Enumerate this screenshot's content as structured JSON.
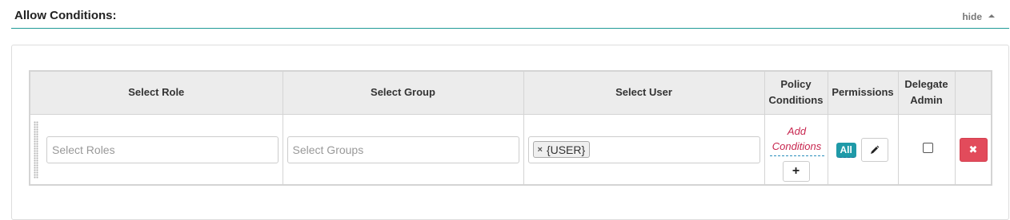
{
  "section": {
    "title": "Allow Conditions:",
    "toggle_label": "hide"
  },
  "table": {
    "headers": {
      "role": "Select Role",
      "group": "Select Group",
      "user": "Select User",
      "policy_line1": "Policy",
      "policy_line2": "Conditions",
      "permissions": "Permissions",
      "delegate_line1": "Delegate",
      "delegate_line2": "Admin"
    },
    "row": {
      "roles_placeholder": "Select Roles",
      "groups_placeholder": "Select Groups",
      "user_tokens": [
        "{USER}"
      ],
      "token_remove": "×",
      "add_conditions_line1": "Add",
      "add_conditions_line2": "Conditions",
      "add_button": "+",
      "permissions_badge": "All",
      "delegate_admin_checked": false,
      "delete_symbol": "✖"
    }
  },
  "colors": {
    "accent": "#1e9b96",
    "badge": "#1f9aa8",
    "danger": "#e24b5b",
    "link": "#c7254e"
  },
  "icons": {
    "toggle": "caret-up-icon",
    "edit": "pencil-icon",
    "delete": "times-icon",
    "add": "plus-icon"
  }
}
